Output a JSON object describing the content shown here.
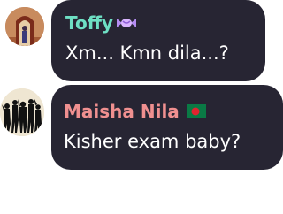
{
  "messages": [
    {
      "sender": "Toffy",
      "text": "Xm... Kmn dila...?",
      "name_color": "#6ee0c4",
      "badge_icon": "candy-icon"
    },
    {
      "sender": "Maisha Nila",
      "text": "Kisher exam baby?",
      "name_color": "#f09090",
      "badge_icon": "bangladesh-flag-icon"
    }
  ],
  "theme": {
    "bubble_color": "#272533",
    "text_color": "#ffffff",
    "background": "#ffffff"
  }
}
